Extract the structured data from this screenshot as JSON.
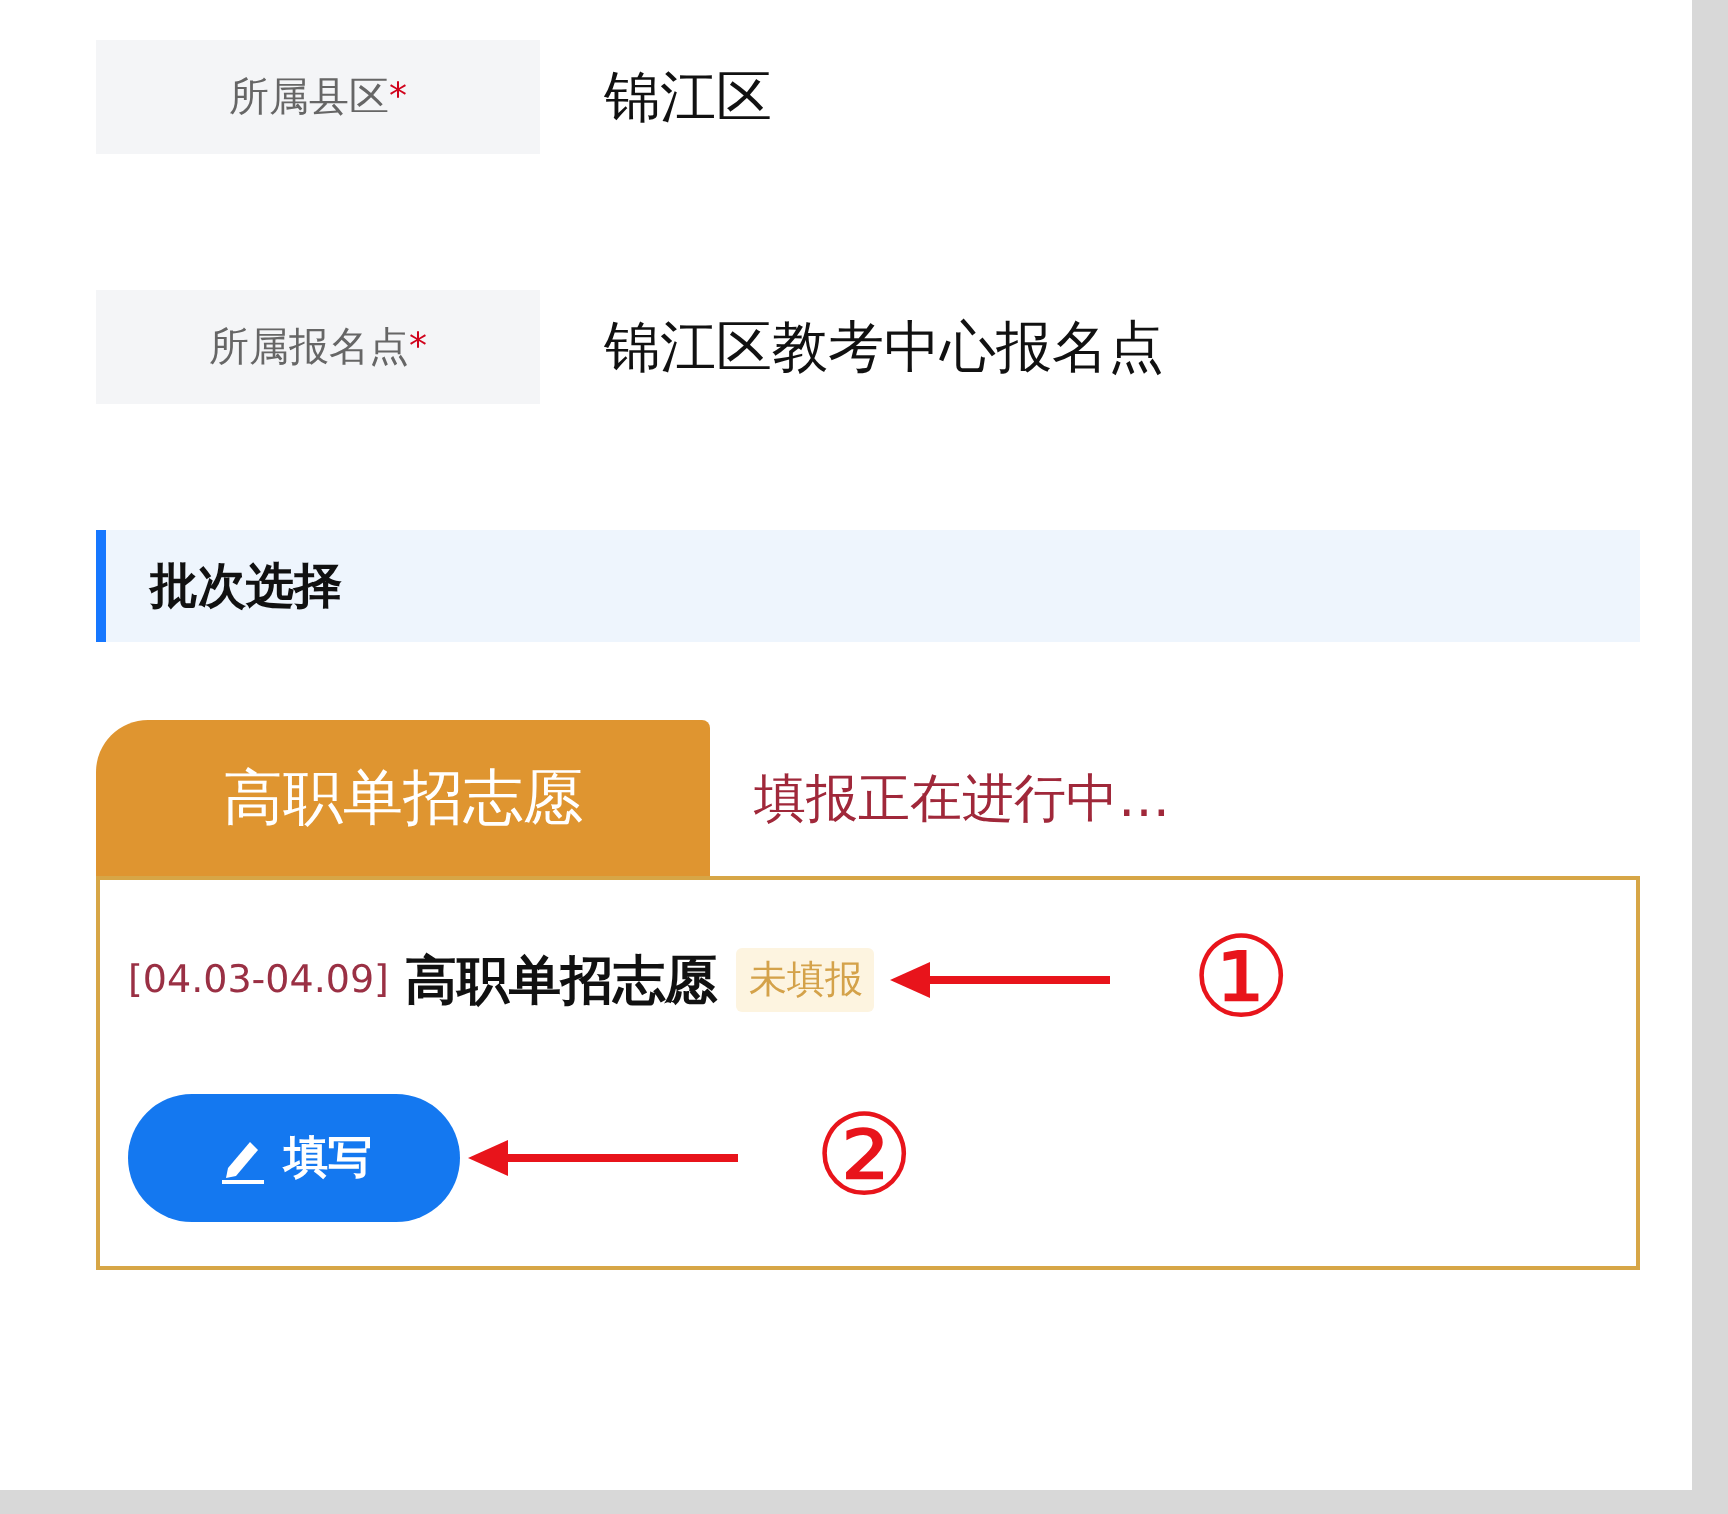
{
  "fields": [
    {
      "label": "所属县区",
      "required_mark": "*",
      "value": "锦江区"
    },
    {
      "label": "所属报名点",
      "required_mark": "*",
      "value": "锦江区教考中心报名点"
    }
  ],
  "section": {
    "title": "批次选择"
  },
  "tabs": [
    {
      "label": "高职单招志愿",
      "selected": true
    }
  ],
  "tab_status": "填报正在进行中…",
  "batches": [
    {
      "date_range": "[04.03-04.09]",
      "title": "高职单招志愿",
      "status": "未填报",
      "button": "填写"
    }
  ],
  "annotations": [
    {
      "kind": "arrow",
      "number": "①"
    },
    {
      "kind": "arrow",
      "number": "②"
    }
  ]
}
